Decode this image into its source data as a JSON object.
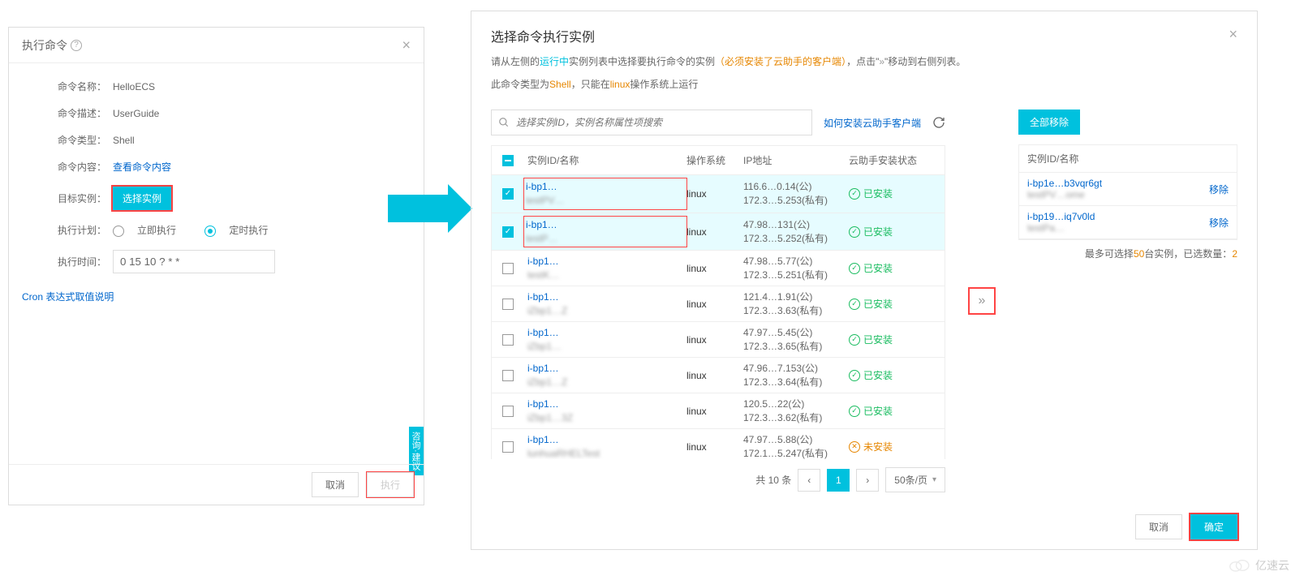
{
  "left": {
    "title": "执行命令",
    "fields": {
      "name_label": "命令名称",
      "name_value": "HelloECS",
      "desc_label": "命令描述",
      "desc_value": "UserGuide",
      "type_label": "命令类型",
      "type_value": "Shell",
      "content_label": "命令内容",
      "content_link": "查看命令内容",
      "target_label": "目标实例",
      "target_button": "选择实例",
      "plan_label": "执行计划",
      "plan_opt1": "立即执行",
      "plan_opt2": "定时执行",
      "time_label": "执行时间",
      "time_value": "0 15 10 ? * *"
    },
    "cron_link": "Cron 表达式取值说明",
    "feedback": "咨询·建议",
    "cancel": "取消",
    "execute": "执行"
  },
  "right": {
    "title": "选择命令执行实例",
    "desc1_a": "请从左侧的",
    "desc1_b": "运行中",
    "desc1_c": "实例列表中选择要执行命令的实例",
    "desc1_d": "（必须安装了云助手的客户端）",
    "desc1_e": "，点击\"",
    "desc1_f": "\"移动到右侧列表。",
    "desc2_a": "此命令类型为",
    "desc2_b": "Shell",
    "desc2_c": "，只能在",
    "desc2_d": "linux",
    "desc2_e": "操作系统上运行",
    "search_placeholder": "选择实例ID，实例名称属性项搜索",
    "help_link": "如何安装云助手客户端",
    "headers": {
      "id": "实例ID/名称",
      "os": "操作系统",
      "ip": "IP地址",
      "status": "云助手安装状态"
    },
    "rows": [
      {
        "checked": true,
        "highlight": true,
        "id": "i-bp1…",
        "name": "testPV…",
        "os": "linux",
        "ip1": "116.6…0.14(公)",
        "ip2": "172.3…5.253(私有)",
        "status": "已安装",
        "ok": true
      },
      {
        "checked": true,
        "highlight": true,
        "id": "i-bp1…",
        "name": "testP…",
        "os": "linux",
        "ip1": "47.98…131(公)",
        "ip2": "172.3…5.252(私有)",
        "status": "已安装",
        "ok": true
      },
      {
        "checked": false,
        "id": "i-bp1…",
        "name": "testK…",
        "os": "linux",
        "ip1": "47.98…5.77(公)",
        "ip2": "172.3…5.251(私有)",
        "status": "已安装",
        "ok": true
      },
      {
        "checked": false,
        "id": "i-bp1…",
        "name": "iZbp1…Z",
        "os": "linux",
        "ip1": "121.4…1.91(公)",
        "ip2": "172.3…3.63(私有)",
        "status": "已安装",
        "ok": true
      },
      {
        "checked": false,
        "id": "i-bp1…",
        "name": "iZbp1…",
        "os": "linux",
        "ip1": "47.97…5.45(公)",
        "ip2": "172.3…3.65(私有)",
        "status": "已安装",
        "ok": true
      },
      {
        "checked": false,
        "id": "i-bp1…",
        "name": "iZbp1…Z",
        "os": "linux",
        "ip1": "47.96…7.153(公)",
        "ip2": "172.3…3.64(私有)",
        "status": "已安装",
        "ok": true
      },
      {
        "checked": false,
        "id": "i-bp1…",
        "name": "iZbp1…3Z",
        "os": "linux",
        "ip1": "120.5…22(公)",
        "ip2": "172.3…3.62(私有)",
        "status": "已安装",
        "ok": true
      },
      {
        "checked": false,
        "id": "i-bp1…",
        "name": "lunhuaRHELTest",
        "os": "linux",
        "ip1": "47.97…5.88(公)",
        "ip2": "172.1…5.247(私有)",
        "status": "未安装",
        "ok": false
      }
    ],
    "total": "共 10 条",
    "page": "1",
    "per_page": "50条/页",
    "transfer": "»",
    "remove_all": "全部移除",
    "sel_header": "实例ID/名称",
    "selected": [
      {
        "id": "i-bp1e…b3vqr6gt",
        "name": "testPV…ome",
        "action": "移除"
      },
      {
        "id": "i-bp19…iq7v0ld",
        "name": "testPa…",
        "action": "移除"
      }
    ],
    "footer_a": "最多可选择",
    "footer_b": "50",
    "footer_c": "台实例，已选数量：",
    "footer_d": "2",
    "cancel": "取消",
    "confirm": "确定"
  },
  "watermark": "亿速云"
}
